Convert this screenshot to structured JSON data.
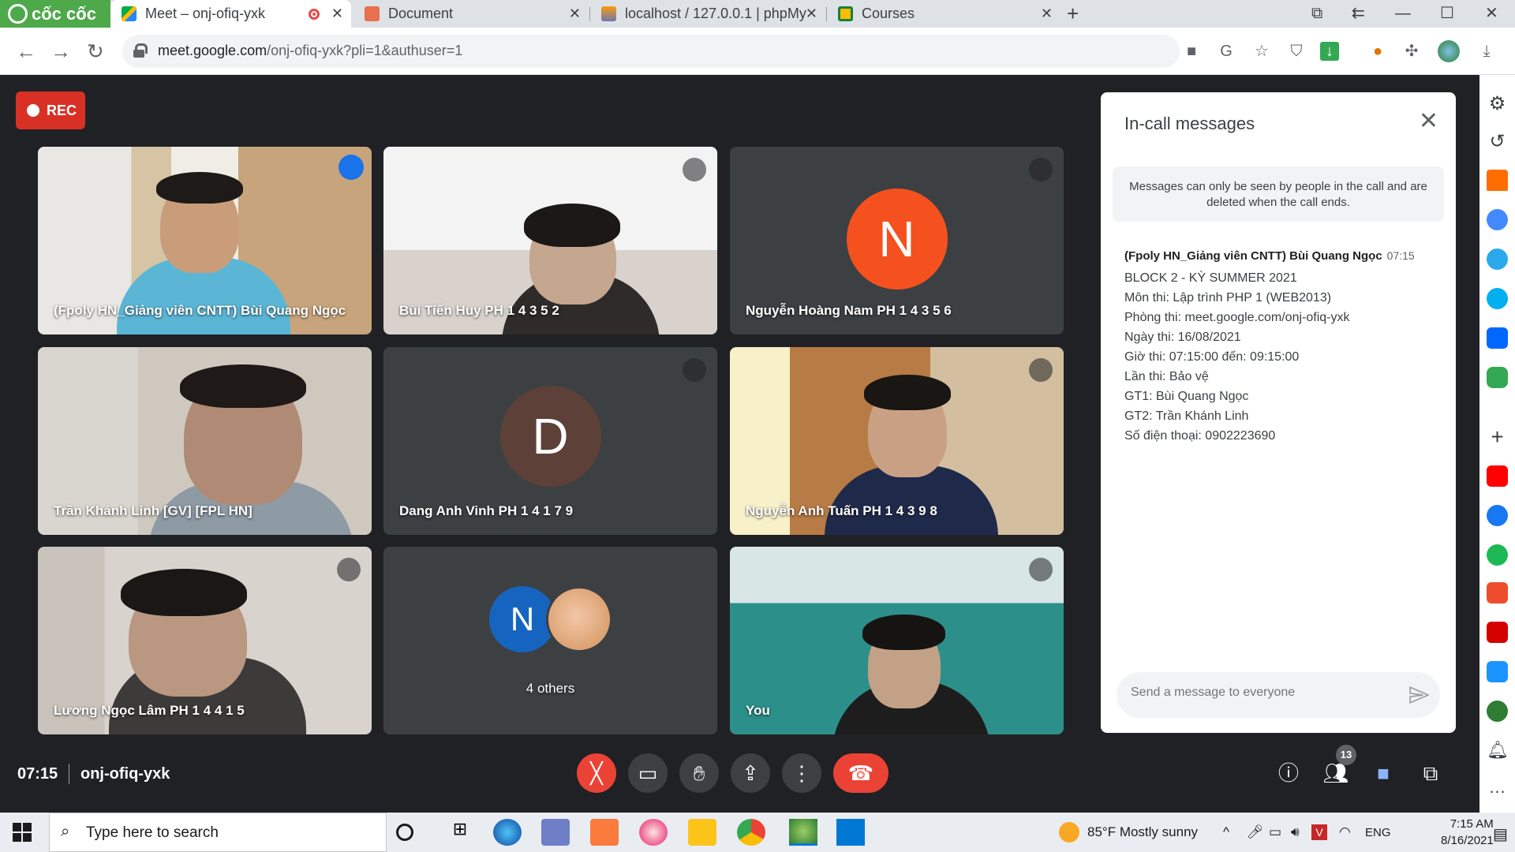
{
  "browser": {
    "brand": "cốc cốc",
    "tabs": [
      {
        "title": "Meet – onj-ofiq-yxk",
        "active": true
      },
      {
        "title": "Document"
      },
      {
        "title": "localhost / 127.0.0.1 | phpMy"
      },
      {
        "title": "Courses"
      }
    ],
    "url_host": "meet.google.com",
    "url_path": "/onj-ofiq-yxk?pli=1&authuser=1"
  },
  "meet": {
    "rec_label": "REC",
    "meeting_time": "07:15",
    "meeting_code": "onj-ofiq-yxk",
    "participant_count": "13",
    "tiles": [
      {
        "name": "(Fpoly HN_Giảng viên CNTT) Bùi Quang Ngọc"
      },
      {
        "name": "Bùi Tiến Huy PH 1 4 3 5 2"
      },
      {
        "name": "Nguyễn Hoàng Nam PH 1 4 3 5 6",
        "initial": "N"
      },
      {
        "name": "Trần Khánh Linh [GV] [FPL HN]"
      },
      {
        "name": "Dang Anh Vinh PH 1 4 1 7 9",
        "initial": "D"
      },
      {
        "name": "Nguyễn Anh Tuấn PH 1 4 3 9 8"
      },
      {
        "name": "Lương Ngọc Lâm PH 1 4 4 1 5"
      },
      {
        "name": "4 others",
        "initial": "N"
      },
      {
        "name": "You"
      }
    ]
  },
  "chat": {
    "title": "In-call messages",
    "notice": "Messages can only be seen by people in the call and are deleted when the call ends.",
    "message": {
      "sender": "(Fpoly HN_Giảng viên CNTT) Bùi Quang Ngọc",
      "time": "07:15",
      "lines": [
        "BLOCK 2 - KỲ SUMMER 2021",
        "Môn thi: Lập trình PHP 1 (WEB2013)",
        "Phòng thi: meet.google.com/onj-ofiq-yxk",
        "Ngày thi: 16/08/2021",
        "Giờ thi: 07:15:00 đến: 09:15:00",
        "Lần thi: Bảo vệ",
        "GT1: Bùi Quang Ngọc",
        "GT2: Trần Khánh Linh",
        "Số điện thoại: 0902223690"
      ]
    },
    "input_placeholder": "Send a message to everyone"
  },
  "taskbar": {
    "search_placeholder": "Type here to search",
    "weather": "85°F  Mostly sunny",
    "language": "ENG",
    "time": "7:15 AM",
    "date": "8/16/2021"
  },
  "colors": {
    "meet_bg": "#202124",
    "tile_bg": "#3c4043",
    "rec_red": "#d93025",
    "end_call_red": "#ea4335",
    "speaking_blue": "#8ab4f8",
    "avatar_orange": "#f4511e",
    "avatar_brown": "#5d4037",
    "avatar_blue": "#1565c0",
    "coccoc_green": "#4ea94b"
  }
}
